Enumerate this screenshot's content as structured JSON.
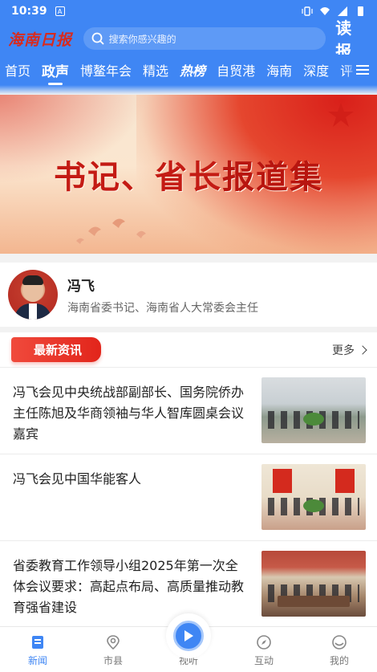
{
  "status_bar": {
    "time": "10:39",
    "notif_letter": "A"
  },
  "header": {
    "logo": "海南日报",
    "search_placeholder": "搜索你感兴趣的",
    "brand": "读报"
  },
  "nav": {
    "tabs": [
      {
        "label": "首页"
      },
      {
        "label": "政声"
      },
      {
        "label": "博鳌年会"
      },
      {
        "label": "精选"
      },
      {
        "label": "热榜"
      },
      {
        "label": "自贸港"
      },
      {
        "label": "海南"
      },
      {
        "label": "深度"
      },
      {
        "label": "评"
      }
    ]
  },
  "banner": {
    "title_part1": "书记、省长",
    "title_part2": "报道集"
  },
  "profile": {
    "name": "冯飞",
    "title": "海南省委书记、海南省人大常委会主任"
  },
  "news": {
    "section_label": "最新资讯",
    "more_label": "更多",
    "items": [
      {
        "title": "冯飞会见中央统战部副部长、国务院侨办主任陈旭及华商领袖与华人智库圆桌会议嘉宾"
      },
      {
        "title": "冯飞会见中国华能客人"
      },
      {
        "title": "省委教育工作领导小组2025年第一次全体会议要求：高起点布局、高质量推动教育强省建设"
      }
    ]
  },
  "tabbar": {
    "items": [
      {
        "label": "新闻"
      },
      {
        "label": "市县"
      },
      {
        "label": "视听"
      },
      {
        "label": "互动"
      },
      {
        "label": "我的"
      }
    ]
  },
  "colors": {
    "primary": "#3f86f4",
    "accent_red": "#e2251b"
  }
}
